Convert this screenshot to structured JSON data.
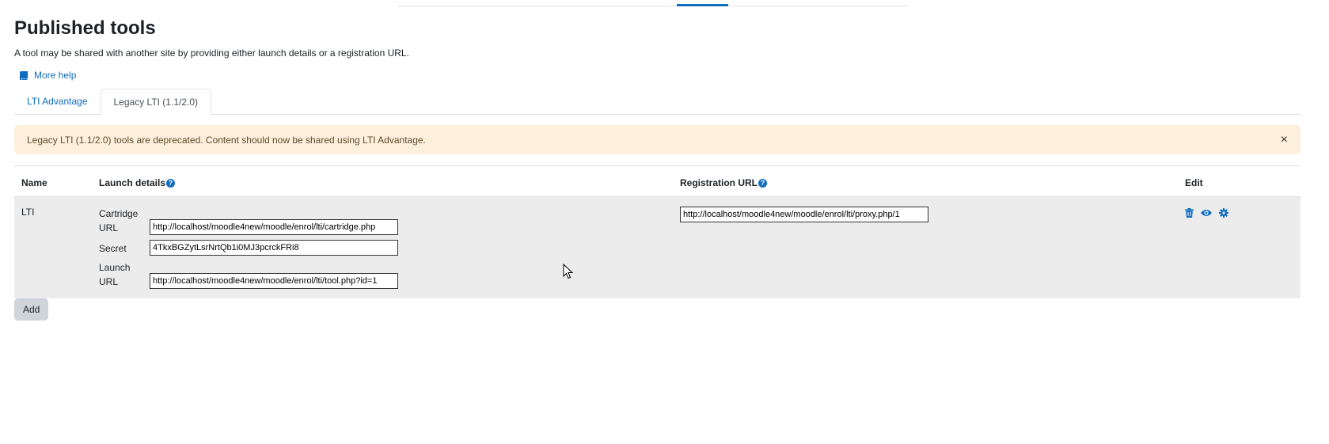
{
  "page_title": "Published tools",
  "intro_text": "A tool may be shared with another site by providing either launch details or a registration URL.",
  "more_help": "More help",
  "tabs": [
    {
      "label": "LTI Advantage"
    },
    {
      "label": "Legacy LTI (1.1/2.0)"
    }
  ],
  "alert": {
    "message": "Legacy LTI (1.1/2.0) tools are deprecated. Content should now be shared using LTI Advantage.",
    "close": "×"
  },
  "table": {
    "headers": {
      "name": "Name",
      "launch": "Launch details",
      "registration": "Registration URL",
      "edit": "Edit"
    },
    "help_glyph": "?",
    "row": {
      "name": "LTI",
      "cartridge_label": "Cartridge URL",
      "cartridge_value": "http://localhost/moodle4new/moodle/enrol/lti/cartridge.php",
      "secret_label": "Secret",
      "secret_value": "4TkxBGZytLsrNrtQb1i0MJ3pcrckFRi8",
      "launch_label": "Launch URL",
      "launch_value": "http://localhost/moodle4new/moodle/enrol/lti/tool.php?id=1",
      "registration_value": "http://localhost/moodle4new/moodle/enrol/lti/proxy.php/1"
    },
    "edit_icons": [
      "trash-icon",
      "eye-icon",
      "gear-icon"
    ]
  },
  "add_button": "Add",
  "colors": {
    "link": "#0f6cbf",
    "alert_bg": "#fcefdc",
    "row_bg": "#ececec",
    "button_bg": "#ced4da"
  }
}
